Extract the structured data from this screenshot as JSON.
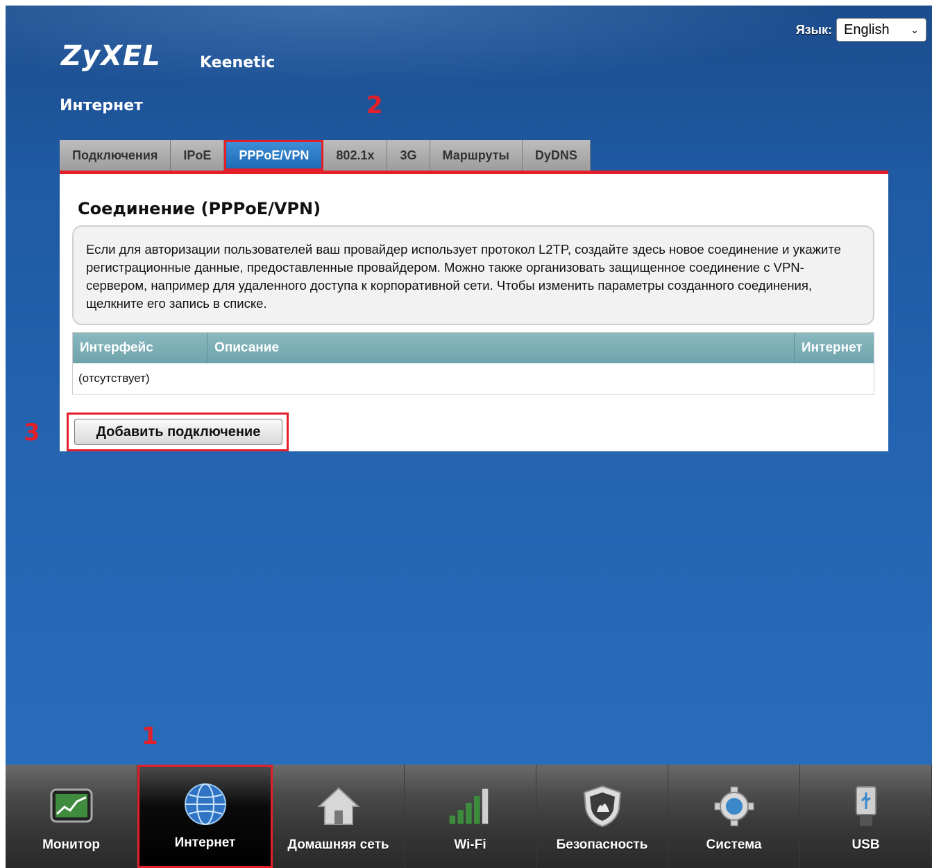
{
  "header": {
    "brand": "ZyXEL",
    "product": "Keenetic",
    "lang_label": "Язык:",
    "lang_value": "English",
    "page_title": "Интернет"
  },
  "annotations": {
    "a1": "1",
    "a2": "2",
    "a3": "3"
  },
  "tabs": [
    {
      "label": "Подключения"
    },
    {
      "label": "IPoE"
    },
    {
      "label": "PPPoE/VPN"
    },
    {
      "label": "802.1x"
    },
    {
      "label": "3G"
    },
    {
      "label": "Маршруты"
    },
    {
      "label": "DyDNS"
    }
  ],
  "panel": {
    "title": "Соединение (PPPoE/VPN)",
    "info": "Если для авторизации пользователей ваш провайдер использует протокол L2TP, создайте здесь новое соединение и укажите регистрационные данные, предоставленные провайдером. Можно также организовать защищенное соединение с VPN-сервером, например для удаленного доступа к корпоративной сети. Чтобы изменить параметры созданного соединения, щелкните его запись в списке.",
    "columns": [
      "Интерфейс",
      "Описание",
      "Интернет"
    ],
    "empty_row": "(отсутствует)",
    "add_button": "Добавить подключение"
  },
  "bottom_nav": [
    {
      "label": "Монитор",
      "icon": "monitor-icon"
    },
    {
      "label": "Интернет",
      "icon": "globe-icon"
    },
    {
      "label": "Домашняя сеть",
      "icon": "home-icon"
    },
    {
      "label": "Wi-Fi",
      "icon": "wifi-signal-icon"
    },
    {
      "label": "Безопасность",
      "icon": "shield-icon"
    },
    {
      "label": "Система",
      "icon": "gear-icon"
    },
    {
      "label": "USB",
      "icon": "usb-icon"
    }
  ],
  "colors": {
    "accent": "#e3202a",
    "tab_active": "#2a7bc8",
    "table_header": "#7fb1b8"
  }
}
